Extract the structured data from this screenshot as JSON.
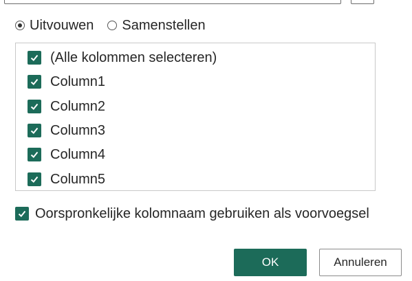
{
  "mode_options": [
    {
      "label": "Uitvouwen",
      "checked": true
    },
    {
      "label": "Samenstellen",
      "checked": false
    }
  ],
  "columns": [
    {
      "label": "(Alle kolommen selecteren)",
      "checked": true
    },
    {
      "label": "Column1",
      "checked": true
    },
    {
      "label": "Column2",
      "checked": true
    },
    {
      "label": "Column3",
      "checked": true
    },
    {
      "label": "Column4",
      "checked": true
    },
    {
      "label": "Column5",
      "checked": true
    }
  ],
  "prefix_option": {
    "label": "Oorspronkelijke kolomnaam gebruiken als voorvoegsel",
    "checked": true
  },
  "buttons": {
    "ok_label": "OK",
    "cancel_label": "Annuleren"
  },
  "colors": {
    "accent": "#1c6b59"
  }
}
